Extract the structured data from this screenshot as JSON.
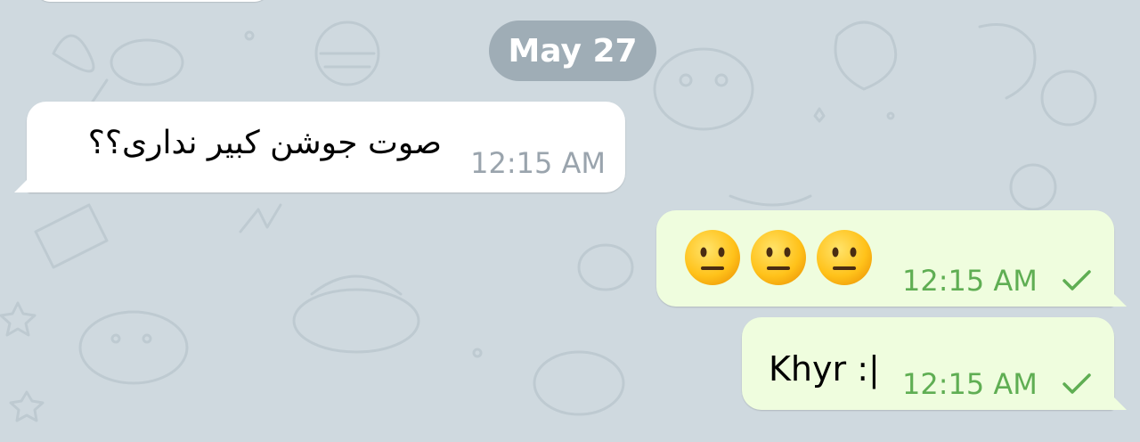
{
  "date_separator": "May 27",
  "messages": [
    {
      "direction": "incoming",
      "text": "صوت جوشن کبیر نداری؟؟",
      "time": "12:15 AM"
    },
    {
      "direction": "outgoing",
      "emojis": [
        "neutral-face",
        "neutral-face",
        "neutral-face"
      ],
      "time": "12:15 AM",
      "status": "sent-check-icon"
    },
    {
      "direction": "outgoing",
      "text": "Khyr :|",
      "time": "12:15 AM",
      "status": "sent-check-icon"
    }
  ],
  "colors": {
    "background": "#cfd9df",
    "incoming_bubble": "#ffffff",
    "outgoing_bubble": "#effdde",
    "outgoing_time": "#5fae53",
    "incoming_time": "#9aa4ad",
    "date_pill": "#96a5af"
  }
}
